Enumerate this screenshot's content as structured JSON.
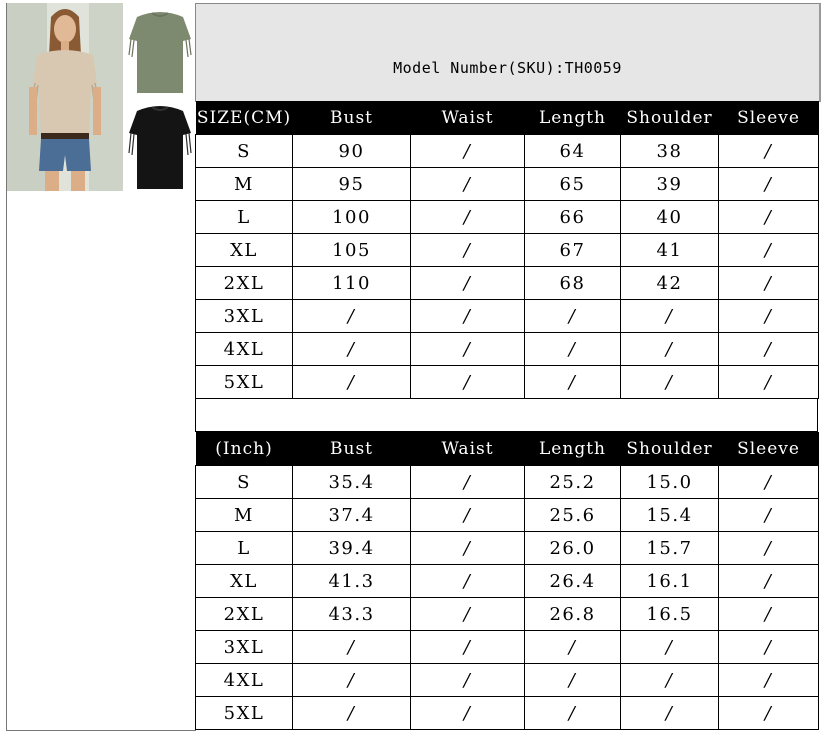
{
  "header": {
    "model_number": "Model Number(SKU):TH0059"
  },
  "images": {
    "model_photo": "woman wearing beige fringe tee",
    "green_tee": "green fringe tee",
    "black_tee": "black fringe tee"
  },
  "colors": {
    "header_bg": "#e6e6e6",
    "table_header_bg": "#000000",
    "beige": "#d8c7b1",
    "green": "#7e8a70",
    "black": "#141414"
  },
  "cm_table": {
    "headers": [
      "SIZE(CM)",
      "Bust",
      "Waist",
      "Length",
      "Shoulder",
      "Sleeve"
    ],
    "rows": [
      [
        "S",
        "90",
        "/",
        "64",
        "38",
        "/"
      ],
      [
        "M",
        "95",
        "/",
        "65",
        "39",
        "/"
      ],
      [
        "L",
        "100",
        "/",
        "66",
        "40",
        "/"
      ],
      [
        "XL",
        "105",
        "/",
        "67",
        "41",
        "/"
      ],
      [
        "2XL",
        "110",
        "/",
        "68",
        "42",
        "/"
      ],
      [
        "3XL",
        "/",
        "/",
        "/",
        "/",
        "/"
      ],
      [
        "4XL",
        "/",
        "/",
        "/",
        "/",
        "/"
      ],
      [
        "5XL",
        "/",
        "/",
        "/",
        "/",
        "/"
      ]
    ]
  },
  "inch_table": {
    "headers": [
      "(Inch)",
      "Bust",
      "Waist",
      "Length",
      "Shoulder",
      "Sleeve"
    ],
    "rows": [
      [
        "S",
        "35.4",
        "/",
        "25.2",
        "15.0",
        "/"
      ],
      [
        "M",
        "37.4",
        "/",
        "25.6",
        "15.4",
        "/"
      ],
      [
        "L",
        "39.4",
        "/",
        "26.0",
        "15.7",
        "/"
      ],
      [
        "XL",
        "41.3",
        "/",
        "26.4",
        "16.1",
        "/"
      ],
      [
        "2XL",
        "43.3",
        "/",
        "26.8",
        "16.5",
        "/"
      ],
      [
        "3XL",
        "/",
        "/",
        "/",
        "/",
        "/"
      ],
      [
        "4XL",
        "/",
        "/",
        "/",
        "/",
        "/"
      ],
      [
        "5XL",
        "/",
        "/",
        "/",
        "/",
        "/"
      ]
    ]
  }
}
